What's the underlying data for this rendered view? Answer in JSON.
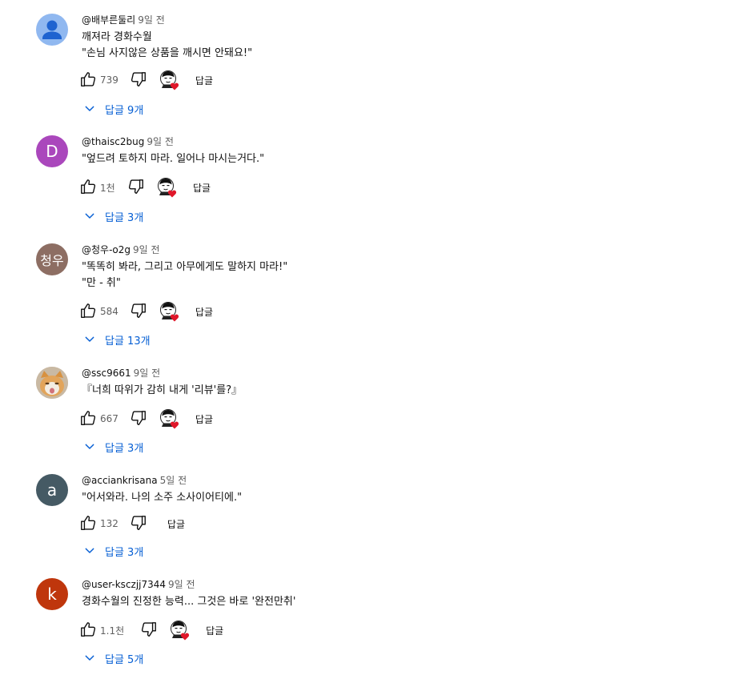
{
  "common": {
    "reply_label": "답글"
  },
  "comments": [
    {
      "author": "@배부른둘리",
      "time": "9일 전",
      "lines": [
        "깨져라 경화수월",
        "\"손님 사지않은 상품을 깨시면 안돼요!\""
      ],
      "likes": "739",
      "replies_label": "답글 9개",
      "avatar": {
        "type": "default-person",
        "color": "#90b8f0"
      },
      "creator_heart": true
    },
    {
      "author": "@thaisc2bug",
      "time": "9일 전",
      "lines": [
        "\"엎드려 토하지 마라. 일어나 마시는거다.\""
      ],
      "likes": "1천",
      "replies_label": "답글 3개",
      "avatar": {
        "type": "letter",
        "letter": "D",
        "color": "#aa47bc"
      },
      "creator_heart": true
    },
    {
      "author": "@청우-o2g",
      "time": "9일 전",
      "lines": [
        "\"똑똑히 봐라, 그리고 아무에게도 말하지 마라!\"",
        "\"만 - 취\""
      ],
      "likes": "584",
      "replies_label": "답글 13개",
      "avatar": {
        "type": "letter",
        "letter": "청우",
        "color": "#8d6e63"
      },
      "creator_heart": true
    },
    {
      "author": "@ssc9661",
      "time": "9일 전",
      "lines": [
        "『너희 따위가 감히 내게 '리뷰'를?』"
      ],
      "likes": "667",
      "replies_label": "답글 3개",
      "avatar": {
        "type": "cat-photo",
        "color": "#c9b9a3"
      },
      "creator_heart": true
    },
    {
      "author": "@acciankrisana",
      "time": "5일 전",
      "lines": [
        "\"어서와라. 나의 소주 소사이어티에.\""
      ],
      "likes": "132",
      "replies_label": "답글 3개",
      "avatar": {
        "type": "letter",
        "letter": "a",
        "color": "#455a64"
      },
      "creator_heart": false
    },
    {
      "author": "@user-ksczjj7344",
      "time": "9일 전",
      "lines": [
        "경화수월의 진정한 능력... 그것은 바로 '완전만취'"
      ],
      "likes": "1.1천",
      "replies_label": "답글 5개",
      "avatar": {
        "type": "letter",
        "letter": "k",
        "color": "#bf360c"
      },
      "creator_heart": true
    }
  ]
}
